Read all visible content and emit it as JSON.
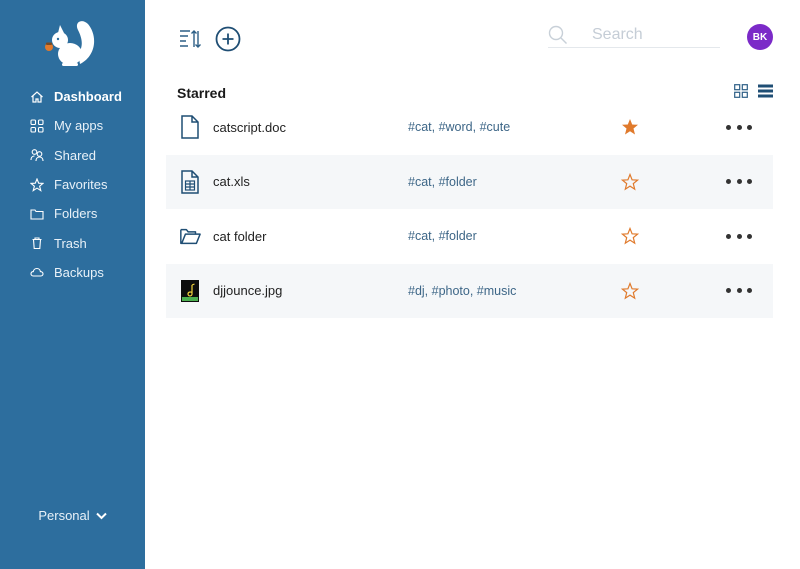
{
  "app": {
    "logo": "squirrel-logo"
  },
  "sidebar": {
    "items": [
      {
        "label": "Dashboard",
        "icon": "home-icon",
        "active": true
      },
      {
        "label": "My apps",
        "icon": "apps-icon",
        "active": false
      },
      {
        "label": "Shared",
        "icon": "shared-icon",
        "active": false
      },
      {
        "label": "Favorites",
        "icon": "star-icon",
        "active": false
      },
      {
        "label": "Folders",
        "icon": "folder-icon",
        "active": false
      },
      {
        "label": "Trash",
        "icon": "trash-icon",
        "active": false
      },
      {
        "label": "Backups",
        "icon": "cloud-icon",
        "active": false
      }
    ],
    "workspace_label": "Personal"
  },
  "toolbar": {
    "sort_icon": "sort-icon",
    "add_icon": "add-circle-icon"
  },
  "search": {
    "placeholder": "Search",
    "value": ""
  },
  "user": {
    "initials": "BK",
    "avatar_color": "#7b2ac8"
  },
  "main": {
    "section_title": "Starred",
    "view_modes": [
      "grid",
      "list"
    ],
    "files": [
      {
        "name": "catscript.doc",
        "tags": "#cat, #word, #cute",
        "icon": "document-icon",
        "starred": true
      },
      {
        "name": "cat.xls",
        "tags": "#cat, #folder",
        "icon": "spreadsheet-icon",
        "starred": false
      },
      {
        "name": "cat folder",
        "tags": "#cat, #folder",
        "icon": "open-folder-icon",
        "starred": false
      },
      {
        "name": "djjounce.jpg",
        "tags": "#dj, #photo, #music",
        "icon": "image-thumbnail",
        "starred": false
      }
    ]
  },
  "colors": {
    "sidebar_bg": "#2d6e9e",
    "accent_blue": "#2d6e9e",
    "star_orange": "#e07a2c",
    "tag_text": "#3d6687"
  }
}
